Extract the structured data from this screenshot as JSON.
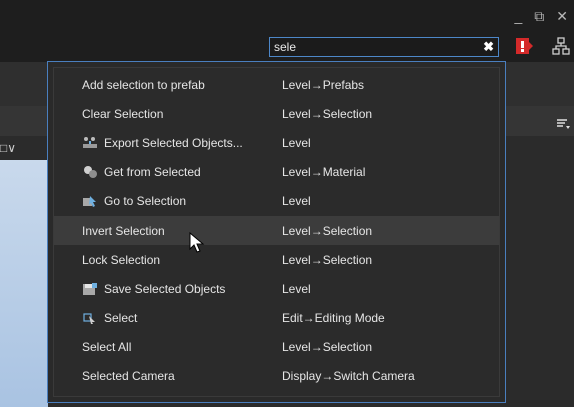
{
  "search": {
    "value": "sele",
    "placeholder": ""
  },
  "window_controls": {
    "minimize": "_",
    "restore": "⧉",
    "close": "✕"
  },
  "left_dropdown": "□∨",
  "results": [
    {
      "label": "Add selection to prefab",
      "path": "Level→Prefabs",
      "icon": ""
    },
    {
      "label": "Clear Selection",
      "path": "Level→Selection",
      "icon": ""
    },
    {
      "label": "Export Selected Objects...",
      "path": "Level",
      "icon": "export-objects-icon"
    },
    {
      "label": "Get from Selected",
      "path": "Level→Material",
      "icon": "material-icon"
    },
    {
      "label": "Go to Selection",
      "path": "Level",
      "icon": "goto-selection-icon"
    },
    {
      "label": "Invert Selection",
      "path": "Level→Selection",
      "icon": ""
    },
    {
      "label": "Lock Selection",
      "path": "Level→Selection",
      "icon": ""
    },
    {
      "label": "Save Selected Objects",
      "path": "Level",
      "icon": "save-objects-icon"
    },
    {
      "label": "Select",
      "path": "Edit→Editing Mode",
      "icon": "select-mode-icon"
    },
    {
      "label": "Select All",
      "path": "Level→Selection",
      "icon": ""
    },
    {
      "label": "Selected Camera",
      "path": "Display→Switch Camera",
      "icon": ""
    }
  ],
  "highlighted_index": 5,
  "colors": {
    "accent": "#4a7fbf",
    "alert": "#e03030",
    "highlight_row": "#3c3c3c"
  }
}
